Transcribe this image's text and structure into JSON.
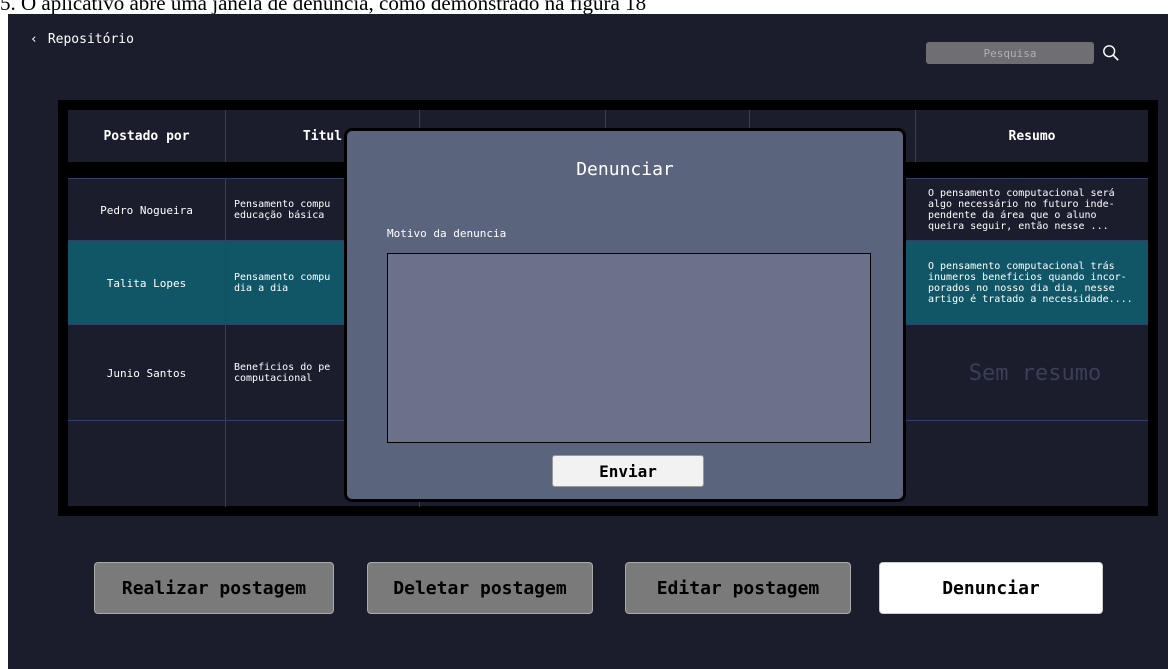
{
  "caption": "5.  O aplicativo abre uma janela de denúncia, como demonstrado na figura 18",
  "topbar": {
    "back_label": "Repositório"
  },
  "search": {
    "placeholder": "Pesquisa"
  },
  "table": {
    "headers": [
      "Postado por",
      "Titul",
      "",
      "",
      "",
      "Resumo"
    ],
    "rows": [
      {
        "author": "Pedro Nogueira",
        "title": "Pensamento compu\neducação básica",
        "summary": "O pensamento computacional será\nalgo necessário no futuro inde-\npendente da área que o aluno\nqueira seguir, então nesse ..."
      },
      {
        "author": "Talita Lopes",
        "title": "Pensamento compu\ndia a dia",
        "summary": "O pensamento computacional trás\ninumeros beneficios quando incor-\nporados no nosso dia dia, nesse\nartigo é tratado a necessidade...."
      },
      {
        "author": "Junio Santos",
        "title": "Beneficios do pe\ncomputacional",
        "summary": "Sem resumo"
      },
      {
        "author": "",
        "title": "",
        "summary": ""
      }
    ]
  },
  "modal": {
    "title": "Denunciar",
    "reason_label": "Motivo da denuncia",
    "send_label": "Enviar"
  },
  "actions": {
    "create": "Realizar postagem",
    "delete": "Deletar postagem",
    "edit": "Editar postagem",
    "report": "Denunciar"
  },
  "colors": {
    "background": "#1b1d2c",
    "selected_row": "#115667",
    "modal": "#5b647d",
    "grid_line": "#30406a"
  }
}
